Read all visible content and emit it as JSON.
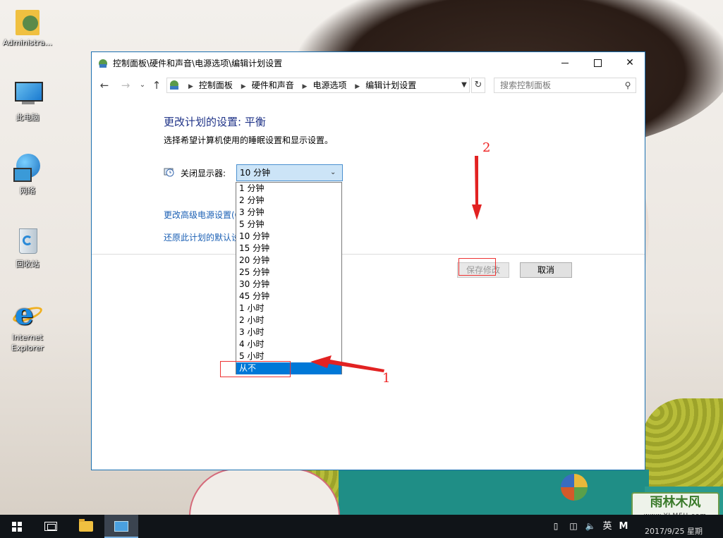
{
  "desktop": {
    "icons": [
      {
        "label": "Administra..."
      },
      {
        "label": "此电脑"
      },
      {
        "label": "网络"
      },
      {
        "label": "回收站"
      },
      {
        "label": "Internet Explorer"
      }
    ],
    "watermark": {
      "top": "雨林木风",
      "bottom": "www.YLMFU.com"
    }
  },
  "window": {
    "title": "控制面板\\硬件和声音\\电源选项\\编辑计划设置",
    "controls": {
      "minimize": "—",
      "maximize": "☐",
      "close": "✕"
    },
    "nav": {
      "back": "←",
      "forward": "→",
      "recent": "⌄",
      "up": "↑"
    },
    "breadcrumbs": [
      "控制面板",
      "硬件和声音",
      "电源选项",
      "编辑计划设置"
    ],
    "search": {
      "placeholder": "搜索控制面板",
      "value": ""
    },
    "heading": "更改计划的设置: 平衡",
    "subtext": "选择希望计算机使用的睡眠设置和显示设置。",
    "display_off": {
      "label": "关闭显示器:",
      "selected": "10 分钟",
      "options": [
        "1 分钟",
        "2 分钟",
        "3 分钟",
        "5 分钟",
        "10 分钟",
        "15 分钟",
        "20 分钟",
        "25 分钟",
        "30 分钟",
        "45 分钟",
        "1 小时",
        "2 小时",
        "3 小时",
        "4 小时",
        "5 小时",
        "从不"
      ],
      "highlighted": "从不"
    },
    "links": {
      "advanced": "更改高级电源设置(C)",
      "restore": "还原此计划的默认设置"
    },
    "buttons": {
      "save": "保存修改",
      "cancel": "取消"
    }
  },
  "annotations": {
    "label1": "1",
    "label2": "2",
    "color": "#e22222"
  },
  "taskbar": {
    "tray": {
      "ime": "英",
      "m": "M",
      "date": "2017/9/25 星期"
    }
  },
  "colors": {
    "heading": "#1e3287",
    "link": "#1a5fb4",
    "selection": "#0078d7",
    "select_bg": "#cce4f7",
    "taskbar": "#101418"
  }
}
